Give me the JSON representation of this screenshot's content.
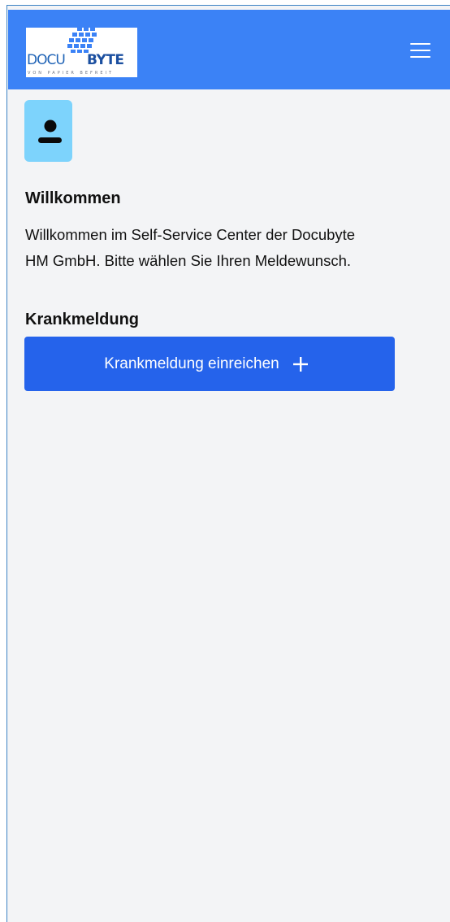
{
  "header": {
    "logo": {
      "word_left": "DOCU",
      "word_right": "BYTE",
      "tagline": "VON PAPIER BEFREIT",
      "brand_color": "#1b4fa0",
      "accent_color": "#3b82f6"
    },
    "menu_icon": "hamburger-menu-icon",
    "background_color": "#3b82f6"
  },
  "profile": {
    "icon": "user-icon",
    "background_color": "#7dd3fc"
  },
  "welcome": {
    "title": "Willkommen",
    "text_line1": "Willkommen im Self-Service Center der Docubyte",
    "text_line2": "HM GmbH. Bitte wählen Sie Ihren Meldewunsch."
  },
  "sick_report": {
    "title": "Krankmeldung",
    "button_label": "Krankmeldung einreichen",
    "button_icon": "plus-icon",
    "button_color": "#2563eb"
  }
}
